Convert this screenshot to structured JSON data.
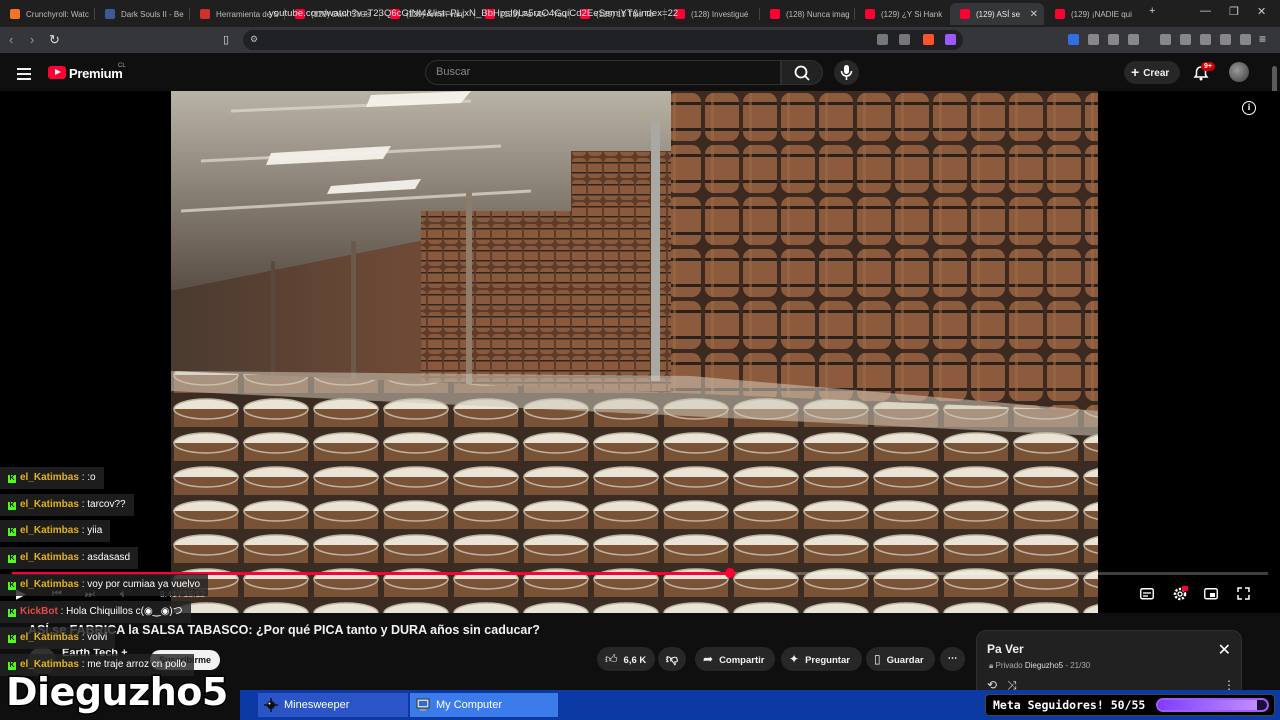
{
  "browser": {
    "tabs": [
      {
        "title": "Crunchyroll: Watc",
        "favicon_color": "#f47521"
      },
      {
        "title": "Dark Souls II - Be",
        "favicon_color": "#3c5a99"
      },
      {
        "title": "Herramienta de S",
        "favicon_color": "#d0312d"
      },
      {
        "title": "(129) Dark Souls",
        "favicon_color": "#ff0033"
      },
      {
        "title": "(129) Armin van",
        "favicon_color": "#ff0033"
      },
      {
        "title": "(129) Pa Ver - You",
        "favicon_color": "#ff0033"
      },
      {
        "title": "(129) 10 Tips To",
        "favicon_color": "#ff0033"
      },
      {
        "title": "(128) Investigué",
        "favicon_color": "#ff0033"
      },
      {
        "title": "(128) Nunca imag",
        "favicon_color": "#ff0033"
      },
      {
        "title": "(129) ¿Y Si Hank",
        "favicon_color": "#ff0033"
      },
      {
        "title": "(129) ASÍ se",
        "favicon_color": "#ff0033",
        "active": true
      },
      {
        "title": "(129) ¡NADIE qui",
        "favicon_color": "#ff0033"
      }
    ],
    "url": "youtube.com/watch?v=T23Q6cGfNI4&list=PLjxN_BbHpsI9Ls5rzO4GqiCd2EeSemiYT&index=22"
  },
  "youtube": {
    "brand": "Premium",
    "brand_region": "CL",
    "search_placeholder": "Buscar",
    "create_label": "Crear",
    "notifications_badge": "9+"
  },
  "player": {
    "time": "8:41 / 15:12",
    "progress_fraction": 0.5715
  },
  "video": {
    "title": "ASÍ se FABRICA la SALSA TABASCO: ¿Por qué PICA tanto y DURA años sin caducar?",
    "channel": "Earth Tech +",
    "subscribe": "Suscribirme",
    "likes": "6,6 K",
    "share": "Compartir",
    "ask": "Preguntar",
    "save": "Guardar"
  },
  "playlist": {
    "title": "Pa Ver",
    "privacy": "Privado",
    "owner": "Dieguzho5",
    "position": "21/30"
  },
  "chat": [
    {
      "user": "el_Katimbas",
      "message": ":o",
      "bot": false
    },
    {
      "user": "el_Katimbas",
      "message": "tarcov??",
      "bot": false
    },
    {
      "user": "el_Katimbas",
      "message": "yiia",
      "bot": false
    },
    {
      "user": "el_Katimbas",
      "message": "asdasasd",
      "bot": false
    },
    {
      "user": "el_Katimbas",
      "message": "voy por cumiaa ya vuelvo",
      "bot": false
    },
    {
      "user": "KickBot",
      "message": "Hola Chiquillos c(◉‿◉)つ",
      "bot": true
    },
    {
      "user": "el_Katimbas",
      "message": "volvi",
      "bot": false
    },
    {
      "user": "el_Katimbas",
      "message": "me traje arroz cn pollo",
      "bot": false
    }
  ],
  "stream": {
    "streamer": "Dieguzho5",
    "taskbar_items": [
      "Minesweeper",
      "My Computer"
    ],
    "goal_label": "Meta Seguidores! 50/55",
    "goal_fraction": 0.909
  }
}
